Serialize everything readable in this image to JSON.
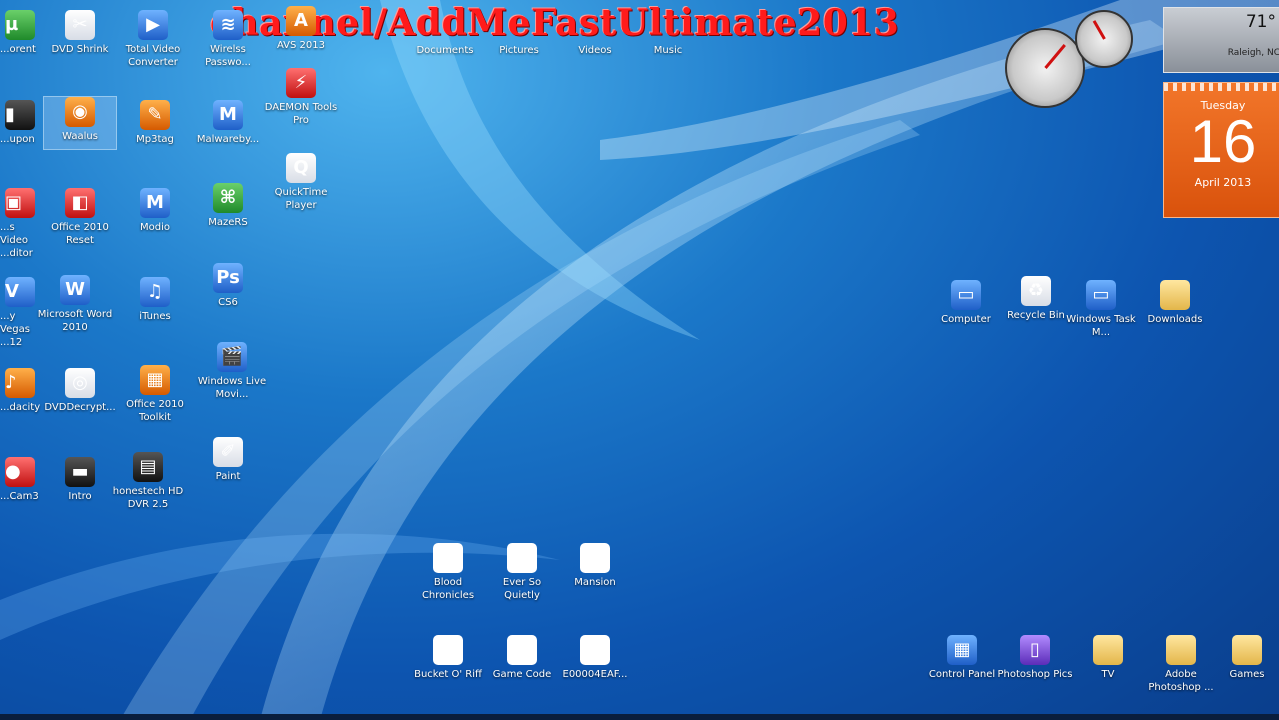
{
  "overlay_title": "channel/AddMeFastUltimate2013",
  "top_labels": [
    "Documents",
    "Pictures",
    "Videos",
    "Music"
  ],
  "desktop_icons": [
    {
      "label": "...orent",
      "icon": "utorrent-icon",
      "color": "g-green",
      "glyph": "µ"
    },
    {
      "label": "DVD Shrink",
      "icon": "dvd-shrink-icon",
      "color": "g-white",
      "glyph": "✂"
    },
    {
      "label": "Total Video Converter",
      "icon": "video-converter-icon",
      "color": "g-blue",
      "glyph": "▶"
    },
    {
      "label": "Wirelss Passwo...",
      "icon": "wifi-password-icon",
      "color": "g-blue",
      "glyph": "≋"
    },
    {
      "label": "AVS 2013",
      "icon": "avs-icon",
      "color": "g-orange",
      "glyph": "A"
    },
    {
      "label": "...upon",
      "icon": "stumbleupon-icon",
      "color": "g-dark",
      "glyph": "▮"
    },
    {
      "label": "Waalus",
      "icon": "firefox-icon",
      "color": "g-orange",
      "glyph": "◉"
    },
    {
      "label": "Mp3tag",
      "icon": "mp3tag-icon",
      "color": "g-orange",
      "glyph": "✎"
    },
    {
      "label": "Malwareby...",
      "icon": "malwarebytes-icon",
      "color": "g-blue",
      "glyph": "M"
    },
    {
      "label": "DAEMON Tools Pro",
      "icon": "daemon-tools-icon",
      "color": "g-red",
      "glyph": "⚡"
    },
    {
      "label": "QuickTime Player",
      "icon": "quicktime-icon",
      "color": "g-white",
      "glyph": "Q"
    },
    {
      "label": "...s Video ...ditor",
      "icon": "video-editor-icon",
      "color": "g-red",
      "glyph": "▣"
    },
    {
      "label": "Office 2010 Reset",
      "icon": "office-reset-icon",
      "color": "g-red",
      "glyph": "◧"
    },
    {
      "label": "Modio",
      "icon": "modio-icon",
      "color": "g-blue",
      "glyph": "M"
    },
    {
      "label": "MazeRS",
      "icon": "mazers-icon",
      "color": "g-green",
      "glyph": "⌘"
    },
    {
      "label": "...y Vegas ...12",
      "icon": "sony-vegas-icon",
      "color": "g-blue",
      "glyph": "V"
    },
    {
      "label": "Microsoft Word 2010",
      "icon": "word-icon",
      "color": "g-blue",
      "glyph": "W"
    },
    {
      "label": "iTunes",
      "icon": "itunes-icon",
      "color": "g-blue",
      "glyph": "♫"
    },
    {
      "label": "CS6",
      "icon": "photoshop-cs6-icon",
      "color": "g-blue",
      "glyph": "Ps"
    },
    {
      "label": "Windows Live Movi...",
      "icon": "movie-maker-icon",
      "color": "g-blue",
      "glyph": "🎬"
    },
    {
      "label": "...dacity",
      "icon": "audacity-icon",
      "color": "g-orange",
      "glyph": "♪"
    },
    {
      "label": "DVDDecrypt...",
      "icon": "dvd-decrypter-icon",
      "color": "g-white",
      "glyph": "◎"
    },
    {
      "label": "Office 2010 Toolkit",
      "icon": "office-toolkit-icon",
      "color": "g-orange",
      "glyph": "▦"
    },
    {
      "label": "Paint",
      "icon": "paint-icon",
      "color": "g-white",
      "glyph": "✐"
    },
    {
      "label": "...Cam3",
      "icon": "camtasia-icon",
      "color": "g-red",
      "glyph": "●"
    },
    {
      "label": "Intro",
      "icon": "intro-video-icon",
      "color": "g-dark",
      "glyph": "▬"
    },
    {
      "label": "honestech HD DVR 2.5",
      "icon": "honestech-icon",
      "color": "g-dark",
      "glyph": "▤"
    },
    {
      "label": "Blood Chronicles",
      "icon": "word-doc-icon",
      "color": "g-doc",
      "glyph": "W"
    },
    {
      "label": "Ever So Quietly",
      "icon": "word-doc-icon",
      "color": "g-doc",
      "glyph": "W"
    },
    {
      "label": "Mansion",
      "icon": "word-doc-icon",
      "color": "g-doc",
      "glyph": "W"
    },
    {
      "label": "Bucket O' Riff",
      "icon": "text-file-icon",
      "color": "g-doc",
      "glyph": ""
    },
    {
      "label": "Game Code",
      "icon": "text-file-icon",
      "color": "g-doc",
      "glyph": ""
    },
    {
      "label": "E00004EAF...",
      "icon": "text-file-icon",
      "color": "g-doc",
      "glyph": ""
    },
    {
      "label": "Computer",
      "icon": "computer-icon",
      "color": "g-blue",
      "glyph": "▭"
    },
    {
      "label": "Recycle Bin",
      "icon": "recycle-bin-icon",
      "color": "g-white",
      "glyph": "♻"
    },
    {
      "label": "Windows Task M...",
      "icon": "task-manager-icon",
      "color": "g-blue",
      "glyph": "▭"
    },
    {
      "label": "Downloads",
      "icon": "downloads-folder-icon",
      "color": "g-folder",
      "glyph": ""
    },
    {
      "label": "Control Panel",
      "icon": "control-panel-icon",
      "color": "g-blue",
      "glyph": "▦"
    },
    {
      "label": "Photoshop Pics",
      "icon": "photoshop-pics-icon",
      "color": "g-purple",
      "glyph": "▯"
    },
    {
      "label": "TV",
      "icon": "tv-folder-icon",
      "color": "g-folder",
      "glyph": ""
    },
    {
      "label": "Adobe Photoshop ...",
      "icon": "adobe-folder-icon",
      "color": "g-folder",
      "glyph": ""
    },
    {
      "label": "Games",
      "icon": "games-folder-icon",
      "color": "g-folder",
      "glyph": ""
    }
  ],
  "weather": {
    "temp": "71°",
    "location": "Raleigh, NC"
  },
  "calendar": {
    "weekday": "Tuesday",
    "day": "16",
    "month_year": "April 2013"
  },
  "selected_icon": "Waalus"
}
